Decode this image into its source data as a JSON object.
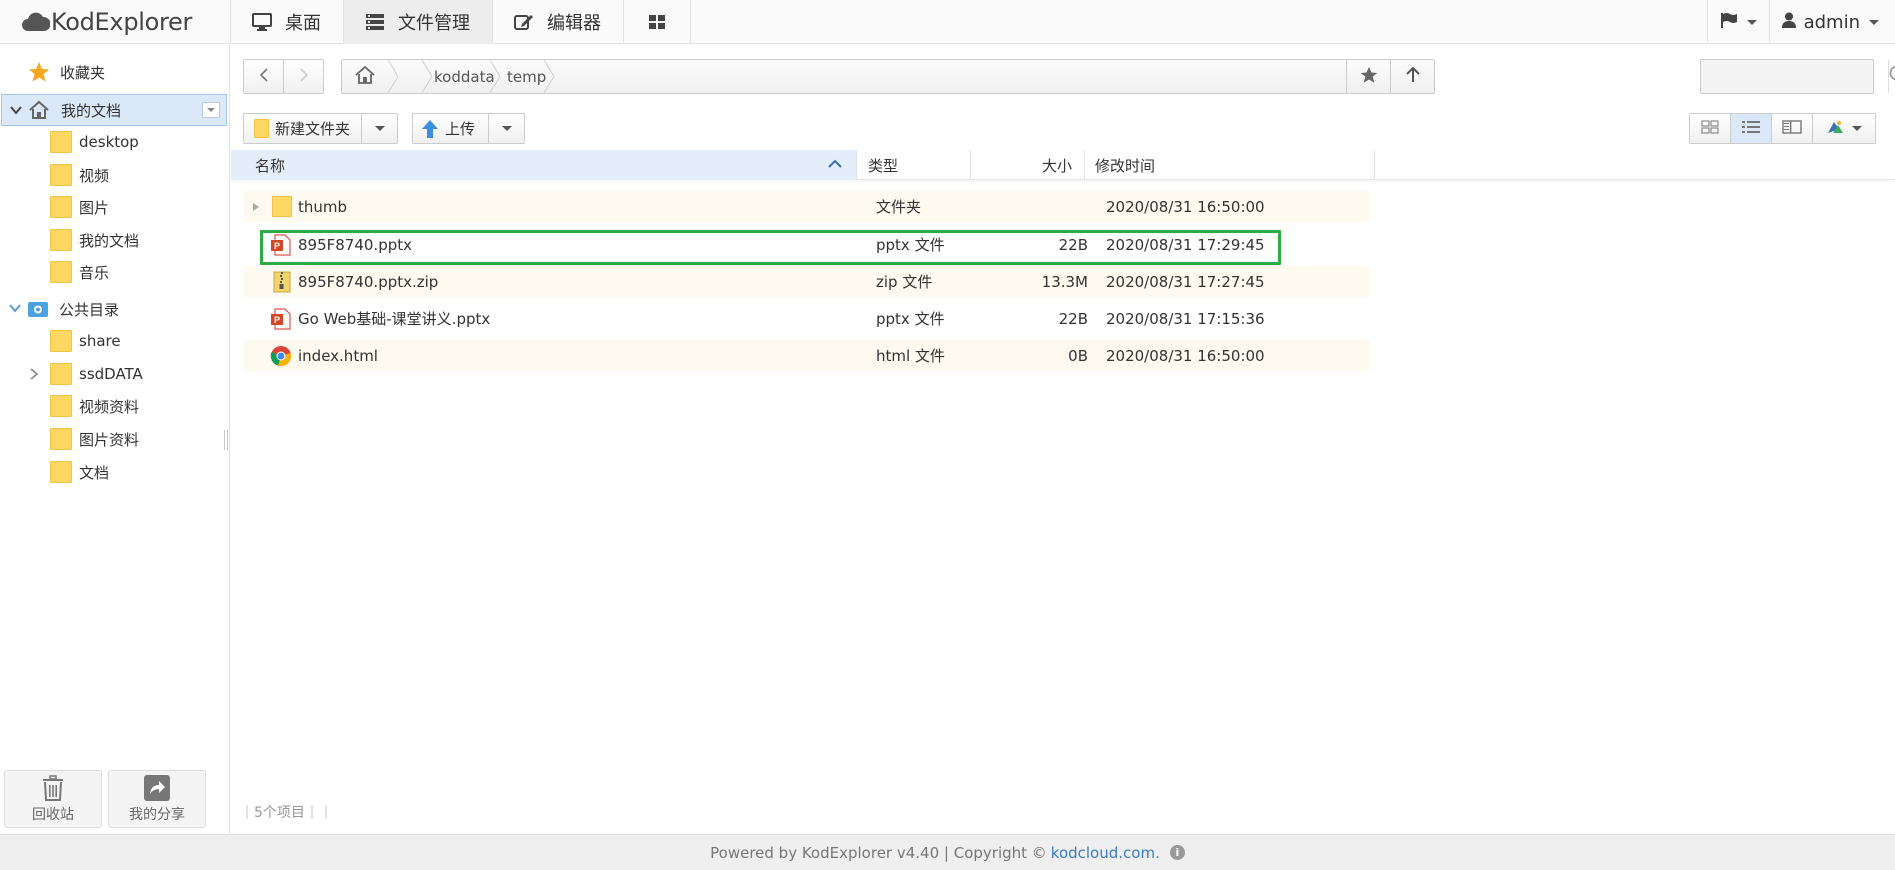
{
  "app": {
    "logo_text": "KodExplorer"
  },
  "topnav": {
    "tabs": [
      {
        "label": "桌面",
        "icon": "monitor-icon"
      },
      {
        "label": "文件管理",
        "icon": "server-icon",
        "active": true
      },
      {
        "label": "编辑器",
        "icon": "edit-icon"
      },
      {
        "label": "",
        "icon": "grid-icon"
      }
    ],
    "user": "admin"
  },
  "sidebar": {
    "favorites": "收藏夹",
    "my_docs": {
      "label": "我的文档",
      "children": [
        "desktop",
        "视频",
        "图片",
        "我的文档",
        "音乐"
      ]
    },
    "public": {
      "label": "公共目录",
      "children": [
        "share",
        "ssdDATA",
        "视频资料",
        "图片资料",
        "文档"
      ]
    },
    "recycle_label": "回收站",
    "share_label": "我的分享"
  },
  "pathbar": {
    "crumbs": [
      "koddata",
      "temp"
    ]
  },
  "toolbar": {
    "new_folder": "新建文件夹",
    "upload": "上传"
  },
  "table": {
    "headers": {
      "name": "名称",
      "type": "类型",
      "size": "大小",
      "mtime": "修改时间"
    },
    "rows": [
      {
        "name": "thumb",
        "type": "文件夹",
        "size": "",
        "mtime": "2020/08/31 16:50:00",
        "icon": "folder-icon"
      },
      {
        "name": "895F8740.pptx",
        "type": "pptx 文件",
        "size": "22B",
        "mtime": "2020/08/31 17:29:45",
        "icon": "pptx-file-icon"
      },
      {
        "name": "895F8740.pptx.zip",
        "type": "zip 文件",
        "size": "13.3M",
        "mtime": "2020/08/31 17:27:45",
        "icon": "zip-file-icon"
      },
      {
        "name": "Go Web基础-课堂讲义.pptx",
        "type": "pptx 文件",
        "size": "22B",
        "mtime": "2020/08/31 17:15:36",
        "icon": "pptx-file-icon"
      },
      {
        "name": "index.html",
        "type": "html 文件",
        "size": "0B",
        "mtime": "2020/08/31 16:50:00",
        "icon": "chrome-icon"
      }
    ]
  },
  "status": {
    "count": "5个项目"
  },
  "footer": {
    "text": "Powered by KodExplorer v4.40 | Copyright ©",
    "link": "kodcloud.com",
    "suffix": "."
  },
  "colors": {
    "highlight": "#2eaa47",
    "selected_bg": "#dbe8f8",
    "link": "#3a7bc8",
    "folder": "#ffd864"
  }
}
